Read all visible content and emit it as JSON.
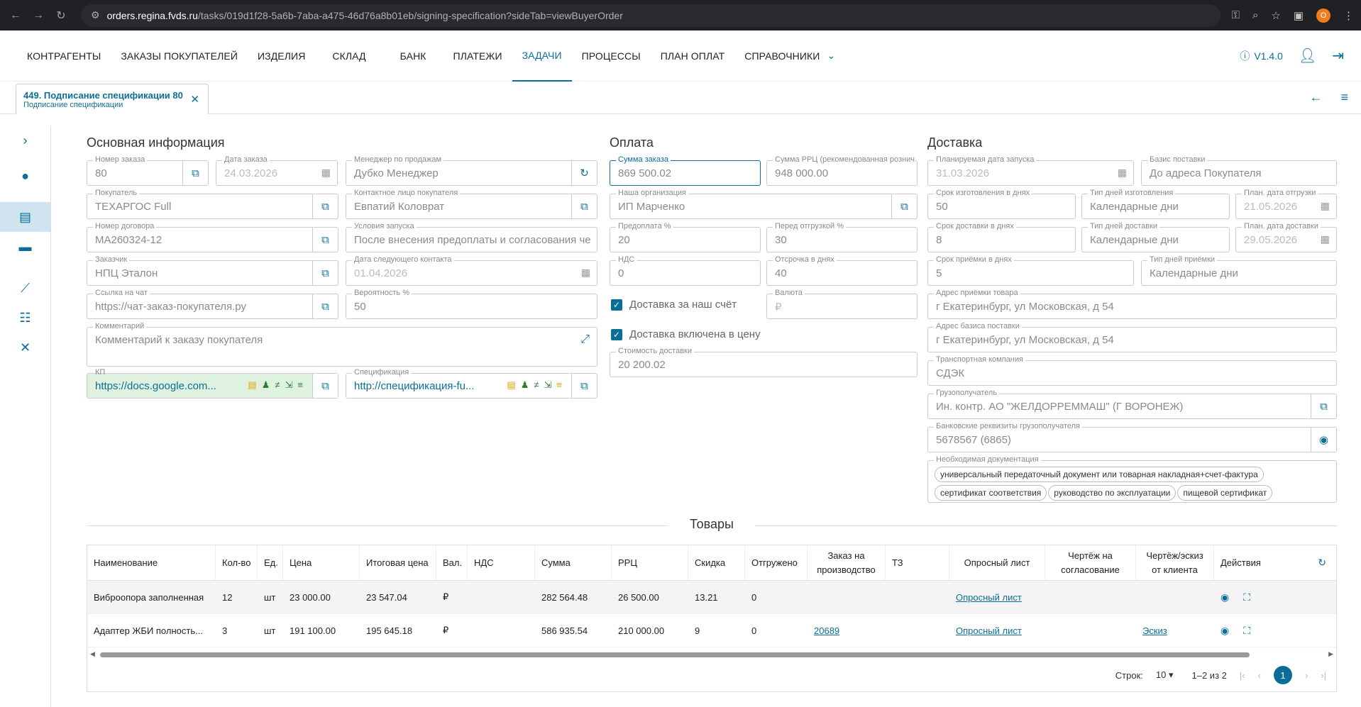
{
  "browser": {
    "url_host": "orders.regina.fvds.ru",
    "url_path": "/tasks/019d1f28-5a6b-7aba-a475-46d76a8b01eb/signing-specification?sideTab=viewBuyerOrder",
    "avatar": "O"
  },
  "nav": {
    "items": [
      "КОНТРАГЕНТЫ",
      "ЗАКАЗЫ ПОКУПАТЕЛЕЙ",
      "ИЗДЕЛИЯ",
      "СКЛАД",
      "БАНК",
      "ПЛАТЕЖИ",
      "ЗАДАЧИ",
      "ПРОЦЕССЫ",
      "ПЛАН ОПЛАТ",
      "СПРАВОЧНИКИ"
    ],
    "version": "V1.4.0"
  },
  "tab": {
    "title": "449. Подписание спецификации 80",
    "subtitle": "Подписание спецификации"
  },
  "main": {
    "title": "Основная информация",
    "order_no_label": "Номер заказа",
    "order_no": "80",
    "order_date_label": "Дата заказа",
    "order_date": "24.03.2026",
    "manager_label": "Менеджер по продажам",
    "manager": "Дубко Менеджер",
    "buyer_label": "Покупатель",
    "buyer": "ТЕХАРГОС Full",
    "contact_label": "Контактное лицо покупателя",
    "contact": "Евпатий Коловрат",
    "contract_label": "Номер договора",
    "contract": "МА260324-12",
    "launch_cond_label": "Условия запуска",
    "launch_cond": "После внесения предоплаты и согласования чертежей",
    "customer_label": "Заказчик",
    "customer": "НПЦ Эталон",
    "next_contact_label": "Дата следующего контакта",
    "next_contact": "01.04.2026",
    "chat_label": "Ссылка на чат",
    "chat": "https://чат-заказ-покупателя.ру",
    "prob_label": "Вероятность %",
    "prob": "50",
    "comment_label": "Комментарий",
    "comment": "Комментарий к заказу покупателя",
    "kp_label": "КП",
    "kp": "https://docs.google.com...",
    "spec_label": "Спецификация",
    "spec": "http://спецификация-fu..."
  },
  "pay": {
    "title": "Оплата",
    "sum_label": "Сумма заказа",
    "sum": "869 500.02",
    "rrc_label": "Сумма РРЦ (рекомендованная розничная цена)",
    "rrc": "948 000.00",
    "org_label": "Наша организация",
    "org": "ИП Марченко",
    "prepay_label": "Предоплата %",
    "prepay": "20",
    "before_ship_label": "Перед отгрузкой %",
    "before_ship": "30",
    "vat_label": "НДС",
    "vat": "0",
    "delay_label": "Отсрочка в днях",
    "delay": "40",
    "delivery_ours": "Доставка за наш счёт",
    "currency_label": "Валюта",
    "currency": "₽",
    "delivery_incl": "Доставка включена в цену",
    "delivery_cost_label": "Стоимость доставки",
    "delivery_cost": "20 200.02"
  },
  "delivery": {
    "title": "Доставка",
    "launch_date_label": "Планируемая дата запуска",
    "launch_date": "31.03.2026",
    "basis_label": "Базис поставки",
    "basis": "До адреса Покупателя",
    "make_days_label": "Срок изготовления в днях",
    "make_days": "50",
    "make_type_label": "Тип дней изготовления",
    "make_type": "Календарные дни",
    "ship_date_label": "План. дата отгрузки",
    "ship_date": "21.05.2026",
    "del_days_label": "Срок доставки в днях",
    "del_days": "8",
    "del_type_label": "Тип дней доставки",
    "del_type": "Календарные дни",
    "del_date_label": "План. дата доставки",
    "del_date": "29.05.2026",
    "acc_days_label": "Срок приёмки в днях",
    "acc_days": "5",
    "acc_type_label": "Тип дней приёмки",
    "acc_type": "Календарные дни",
    "acc_addr_label": "Адрес приёмки товара",
    "acc_addr": "г Екатеринбург, ул Московская, д 54",
    "basis_addr_label": "Адрес базиса поставки",
    "basis_addr": "г Екатеринбург, ул Московская, д 54",
    "carrier_label": "Транспортная компания",
    "carrier": "СДЭК",
    "consignee_label": "Грузополучатель",
    "consignee": "Ин. контр. АО \"ЖЕЛДОРРЕММАШ\" (Г ВОРОНЕЖ)",
    "bank_label": "Банковские реквизиты грузополучателя",
    "bank": "5678567 (6865)",
    "docs_label": "Необходимая документация",
    "docs": [
      "универсальный передаточный документ или товарная накладная+счет-фактура",
      "сертификат соответствия",
      "руководство по эксплуатации",
      "пищевой сертификат"
    ]
  },
  "goods": {
    "title": "Товары",
    "headers": [
      "Наименование",
      "Кол-во",
      "Ед.",
      "Цена",
      "Итоговая цена",
      "Вал.",
      "НДС",
      "Сумма",
      "РРЦ",
      "Скидка",
      "Отгружено",
      "Заказ на производство",
      "ТЗ",
      "Опросный лист",
      "Чертёж на согласование",
      "Чертёж/эскиз от клиента",
      "Действия"
    ],
    "rows": [
      {
        "name": "Виброопора заполненная",
        "qty": "12",
        "unit": "шт",
        "price": "23 000.00",
        "total_price": "23 547.04",
        "cur": "₽",
        "vat": "",
        "sum": "282 564.48",
        "rrc": "26 500.00",
        "disc": "13.21",
        "shipped": "0",
        "prod": "",
        "tz": "",
        "survey": "Опросный лист",
        "drawing": "",
        "sketch": ""
      },
      {
        "name": "Адаптер ЖБИ полность...",
        "qty": "3",
        "unit": "шт",
        "price": "191 100.00",
        "total_price": "195 645.18",
        "cur": "₽",
        "vat": "",
        "sum": "586 935.54",
        "rrc": "210 000.00",
        "disc": "9",
        "shipped": "0",
        "prod": "20689",
        "tz": "",
        "survey": "Опросный лист",
        "drawing": "",
        "sketch": "Эскиз"
      }
    ],
    "rows_label": "Строк:",
    "rows_per_page": "10",
    "range": "1–2 из 2",
    "page": "1"
  }
}
